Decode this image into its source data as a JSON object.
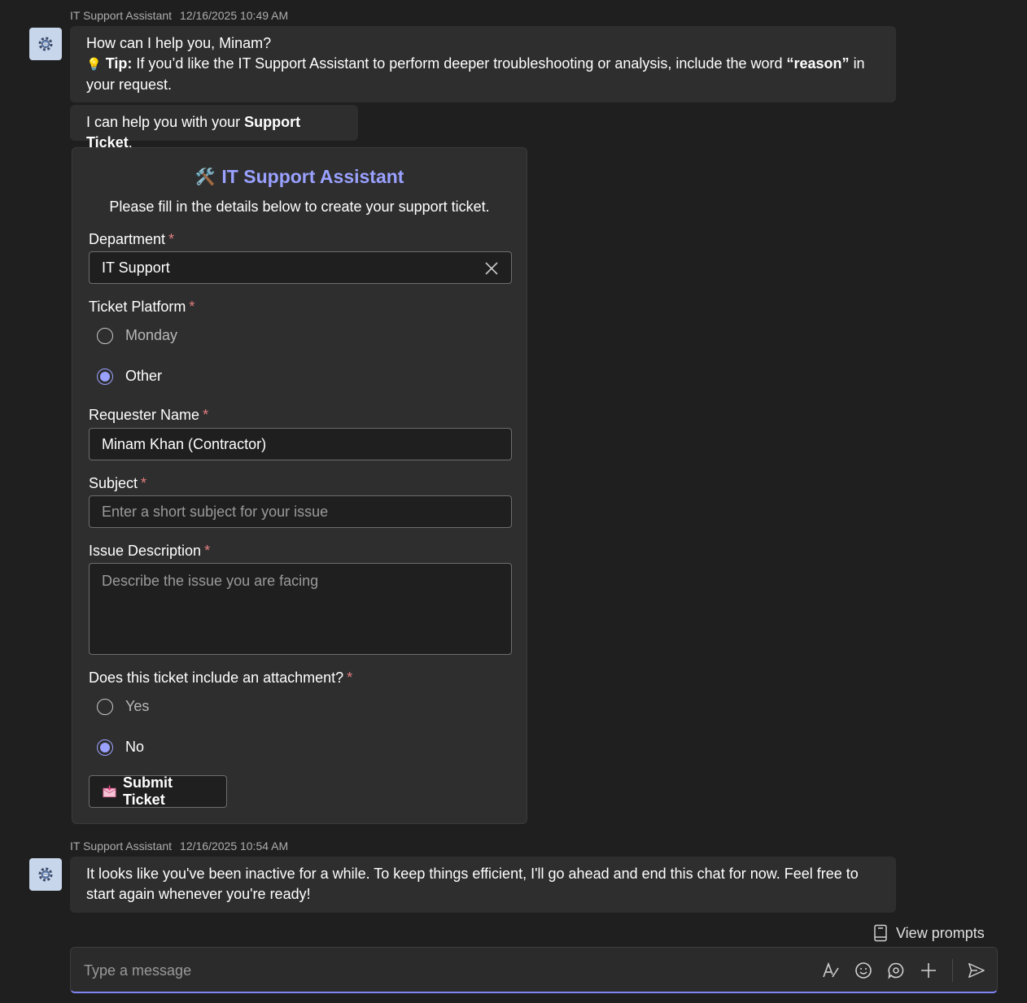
{
  "messages": [
    {
      "sender": "IT Support Assistant",
      "timestamp": "12/16/2025 10:49 AM",
      "greeting": "How can I help you, Minam?",
      "tip_emoji": "💡",
      "tip_label": "Tip:",
      "tip_text_before": "If you’d like the IT Support Assistant to perform deeper troubleshooting or analysis, include the word",
      "tip_keyword": "“reason”",
      "tip_text_after": "in your request.",
      "help_before": "I can help you with your",
      "help_bold": "Support Ticket",
      "help_after": "."
    },
    {
      "sender": "IT Support Assistant",
      "timestamp": "12/16/2025 10:54 AM",
      "text": "It looks like you've been inactive for a while. To keep things efficient, I'll go ahead and end this chat for now. Feel free to start again whenever you're ready!"
    }
  ],
  "card": {
    "title_emoji": "🛠️",
    "title": "IT Support Assistant",
    "subtitle": "Please fill in the details below to create your support ticket.",
    "required_mark": "*",
    "department": {
      "label": "Department",
      "value": "IT Support"
    },
    "platform": {
      "label": "Ticket Platform",
      "options": [
        "Monday",
        "Other"
      ],
      "selected": "Other"
    },
    "requester": {
      "label": "Requester Name",
      "value": "Minam Khan (Contractor)"
    },
    "subject": {
      "label": "Subject",
      "placeholder": "Enter a short subject for your issue"
    },
    "description": {
      "label": "Issue Description",
      "placeholder": "Describe the issue you are facing"
    },
    "attachment": {
      "label": "Does this ticket include an attachment?",
      "options": [
        "Yes",
        "No"
      ],
      "selected": "No"
    },
    "submit_label": "Submit Ticket"
  },
  "view_prompts_label": "View prompts",
  "composer": {
    "placeholder": "Type a message"
  },
  "colors": {
    "accent": "#7f85f5",
    "title": "#9aa1ff",
    "required": "#e37d80"
  }
}
